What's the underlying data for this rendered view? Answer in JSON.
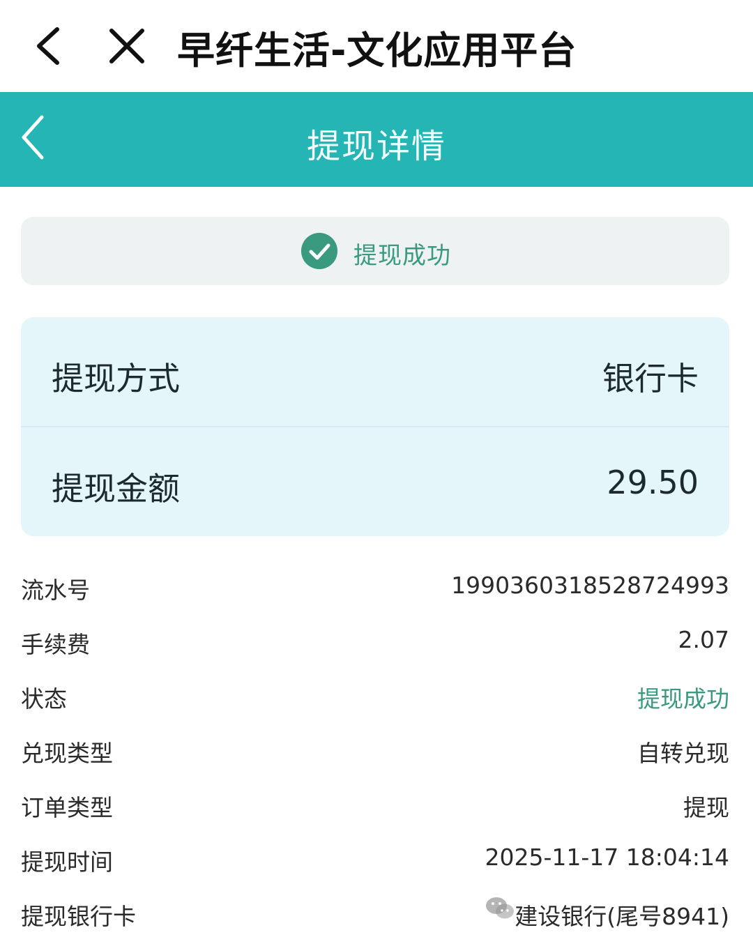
{
  "topbar": {
    "title": "早纤生活-文化应用平台"
  },
  "header": {
    "title": "提现详情"
  },
  "status_banner": {
    "text": "提现成功"
  },
  "summary": [
    {
      "label": "提现方式",
      "value": "银行卡"
    },
    {
      "label": "提现金额",
      "value": "29.50"
    }
  ],
  "details": [
    {
      "label": "流水号",
      "value": "19903603185287249​93"
    },
    {
      "label": "手续费",
      "value": "2.07"
    },
    {
      "label": "状态",
      "value": "提现成功"
    },
    {
      "label": "兑现类型",
      "value": "自转兑现"
    },
    {
      "label": "订单类型",
      "value": "提现"
    },
    {
      "label": "提现时间",
      "value": "2025-11-17 18:04:14"
    },
    {
      "label": "提现银行卡",
      "value": "建设银行(尾号8941)"
    }
  ],
  "colors": {
    "header": "#26b5b5",
    "success": "#3a9a80",
    "card": "#e5f6fb"
  },
  "icons": [
    "back-icon",
    "close-icon",
    "check-circle-icon",
    "wechat-icon"
  ]
}
